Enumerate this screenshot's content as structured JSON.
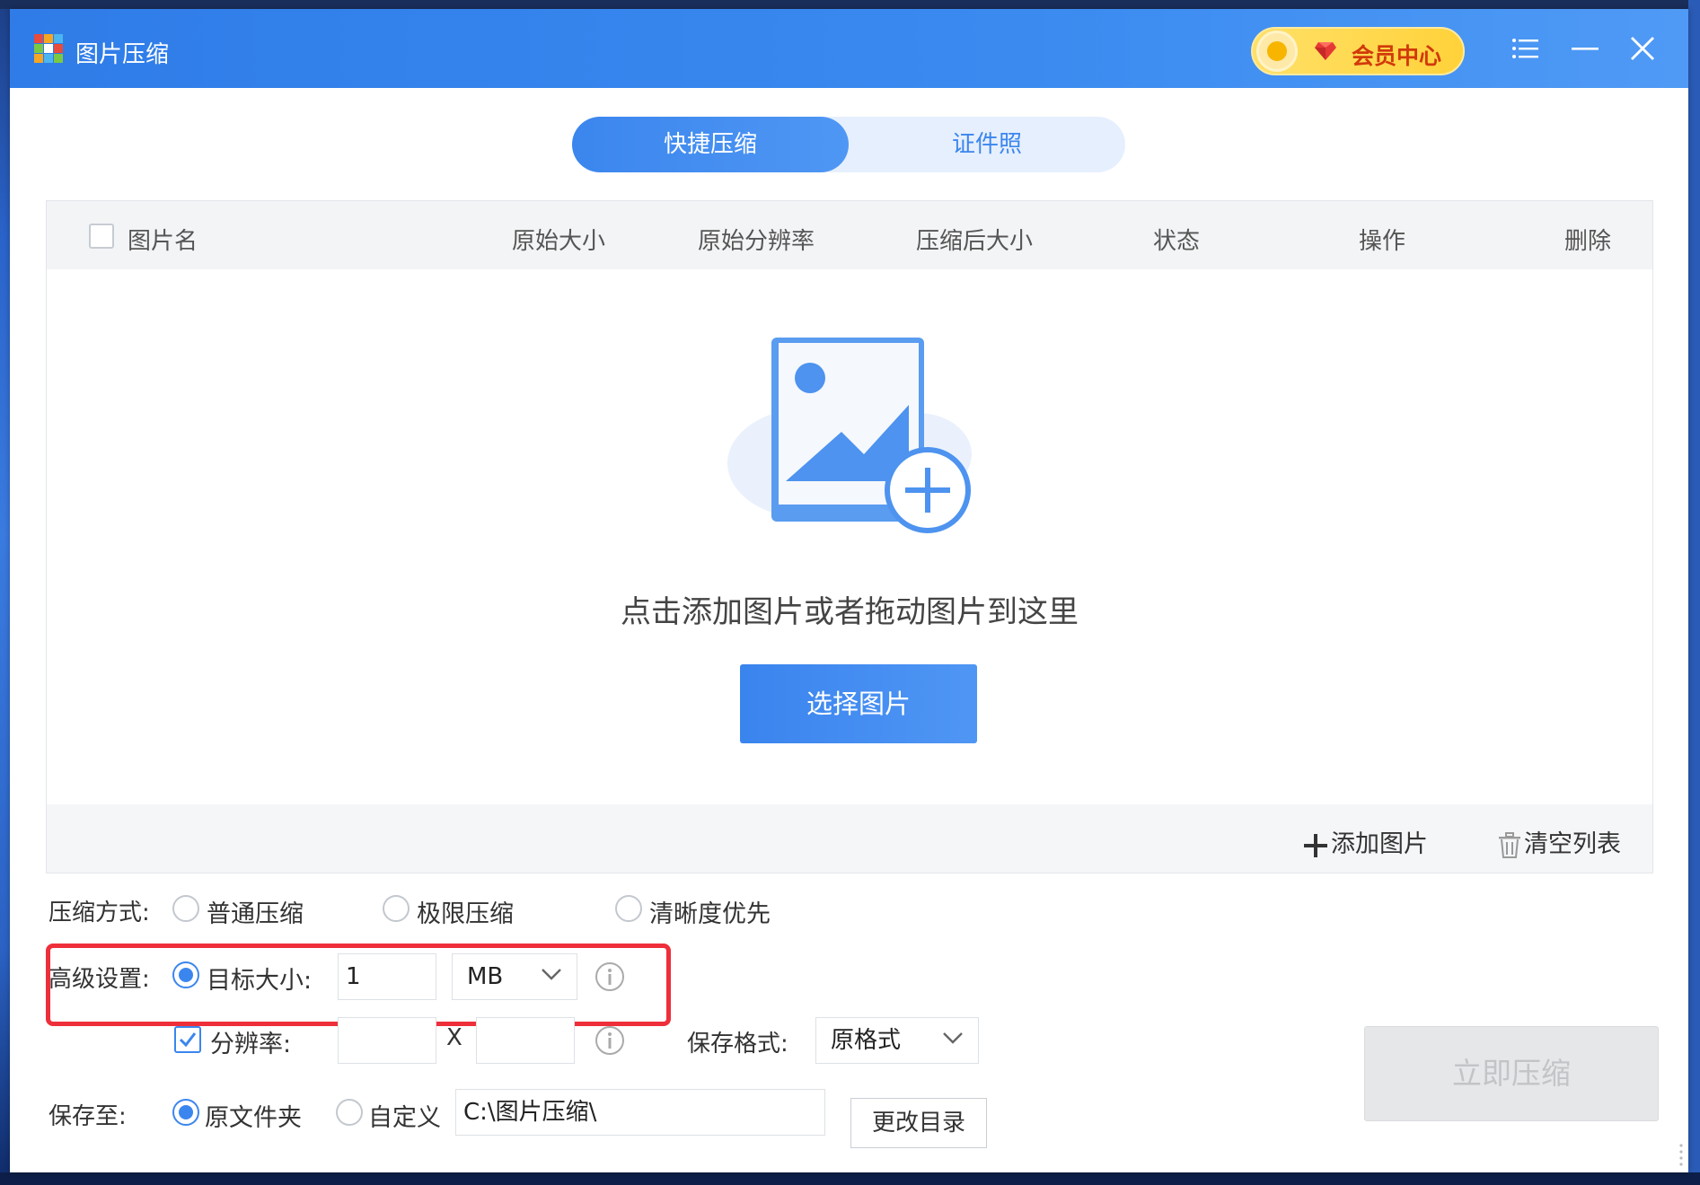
{
  "window": {
    "title": "图片压缩",
    "vip_label": "会员中心"
  },
  "tabs": [
    {
      "label": "快捷压缩",
      "active": true
    },
    {
      "label": "证件照",
      "active": false
    }
  ],
  "list": {
    "columns": [
      "图片名",
      "原始大小",
      "原始分辨率",
      "压缩后大小",
      "状态",
      "操作",
      "删除"
    ],
    "empty_hint": "点击添加图片或者拖动图片到这里",
    "select_button": "选择图片",
    "add_images": "添加图片",
    "clear_list": "清空列表"
  },
  "settings": {
    "mode_label": "压缩方式:",
    "modes": [
      {
        "label": "普通压缩",
        "selected": false
      },
      {
        "label": "极限压缩",
        "selected": false
      },
      {
        "label": "清晰度优先",
        "selected": false
      }
    ],
    "advanced_label": "高级设置:",
    "target_size_label": "目标大小:",
    "target_size_selected": true,
    "target_size_value": "1",
    "target_size_unit": "MB",
    "resolution_label": "分辨率:",
    "resolution_checked": true,
    "resolution_width": "",
    "resolution_height": "",
    "resolution_sep": "X",
    "format_label": "保存格式:",
    "format_value": "原格式",
    "save_to_label": "保存至:",
    "save_options": [
      {
        "label": "原文件夹",
        "selected": true
      },
      {
        "label": "自定义",
        "selected": false
      }
    ],
    "save_path": "C:\\图片压缩\\",
    "change_dir_button": "更改目录",
    "compress_button": "立即压缩"
  },
  "colors": {
    "accent": "#3b86ee",
    "highlight": "#ee2f3a",
    "vip_text": "#d1390a"
  }
}
